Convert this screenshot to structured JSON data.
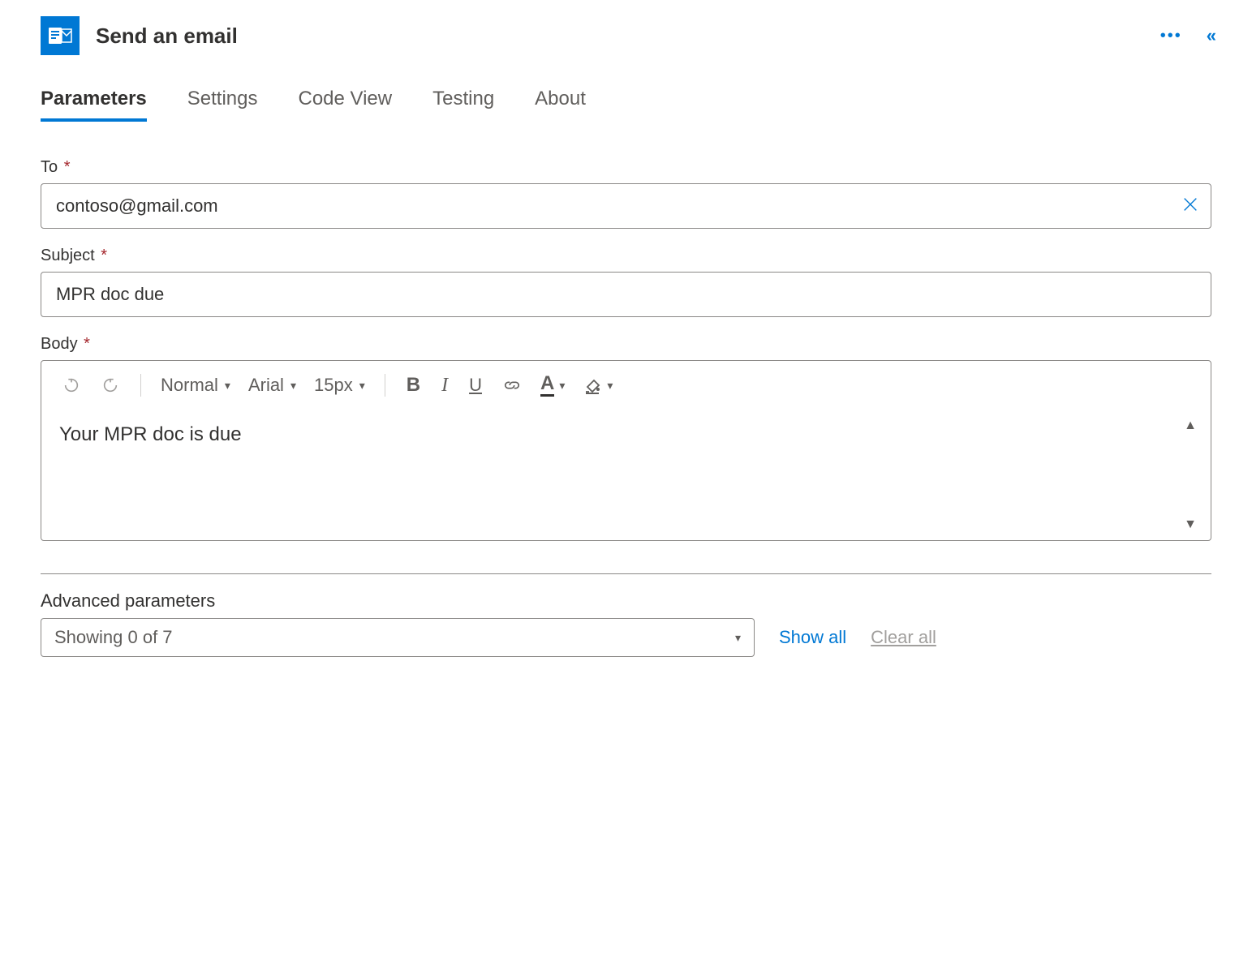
{
  "header": {
    "title": "Send an email"
  },
  "tabs": [
    {
      "label": "Parameters",
      "active": true
    },
    {
      "label": "Settings",
      "active": false
    },
    {
      "label": "Code View",
      "active": false
    },
    {
      "label": "Testing",
      "active": false
    },
    {
      "label": "About",
      "active": false
    }
  ],
  "fields": {
    "to": {
      "label": "To",
      "value": "contoso@gmail.com"
    },
    "subject": {
      "label": "Subject",
      "value": "MPR doc due"
    },
    "body": {
      "label": "Body",
      "value": "Your MPR doc is due"
    }
  },
  "toolbar": {
    "style": "Normal",
    "font": "Arial",
    "size": "15px"
  },
  "advanced": {
    "label": "Advanced parameters",
    "showing": "Showing 0 of 7",
    "show_all": "Show all",
    "clear_all": "Clear all"
  },
  "required_mark": "*"
}
